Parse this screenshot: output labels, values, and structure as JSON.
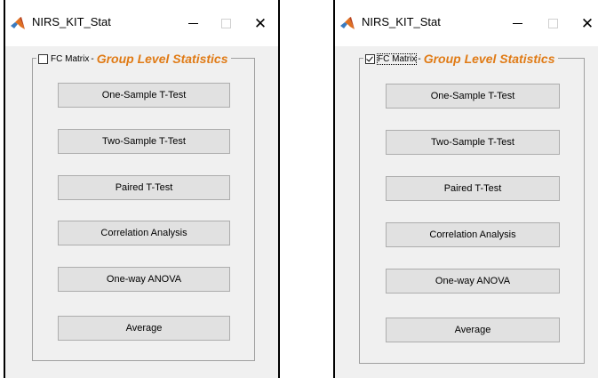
{
  "windows": [
    {
      "title": "NIRS_KIT_Stat",
      "checkbox_label": "FC Matrix",
      "checkbox_checked": false,
      "separator": "-",
      "group_title": "Group Level Statistics",
      "buttons": [
        "One-Sample T-Test",
        "Two-Sample T-Test",
        "Paired T-Test",
        "Correlation Analysis",
        "One-way ANOVA",
        "Average"
      ]
    },
    {
      "title": "NIRS_KIT_Stat",
      "checkbox_label": "FC Matrix",
      "checkbox_checked": true,
      "separator": "-",
      "group_title": "Group Level Statistics",
      "buttons": [
        "One-Sample T-Test",
        "Two-Sample T-Test",
        "Paired T-Test",
        "Correlation Analysis",
        "One-way ANOVA",
        "Average"
      ]
    }
  ],
  "icons": {
    "app": "matlab-icon",
    "minimize": "minimize-icon",
    "maximize": "maximize-icon",
    "close": "close-icon"
  },
  "colors": {
    "group_title": "#e07b16",
    "window_bg": "#f0f0f0",
    "button_bg": "#e1e1e1",
    "button_border": "#adadad"
  }
}
